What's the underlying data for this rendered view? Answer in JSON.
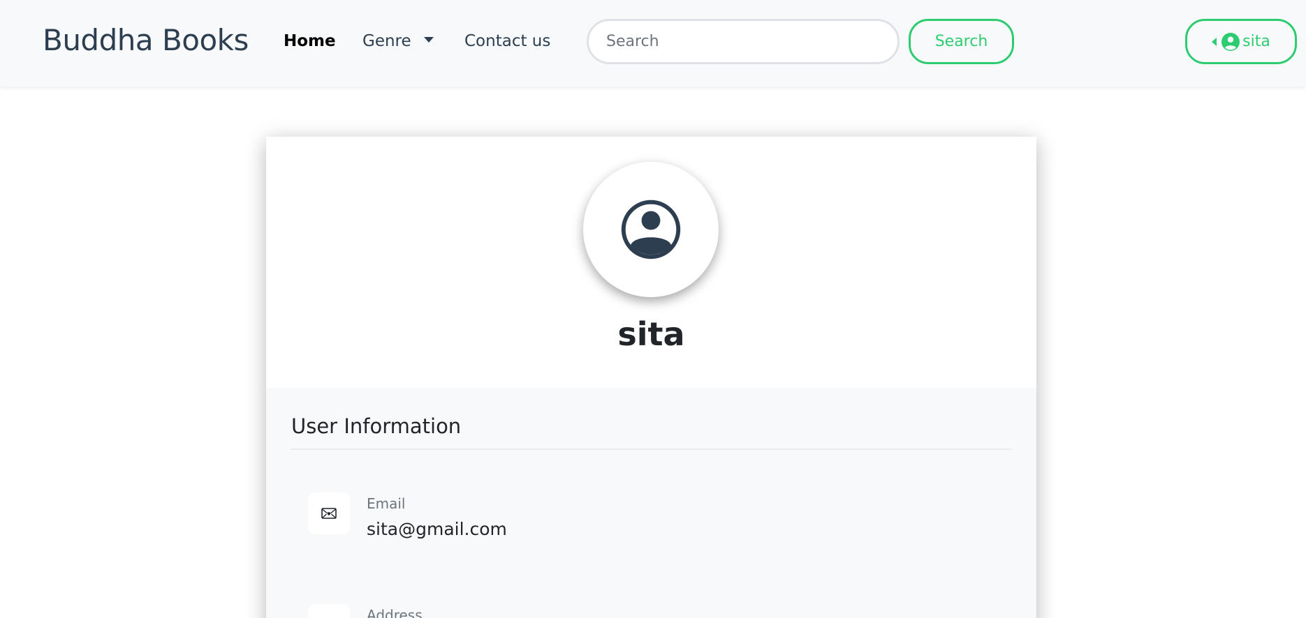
{
  "navbar": {
    "brand": "Buddha Books",
    "links": {
      "home": "Home",
      "genre": "Genre",
      "contact": "Contact us"
    },
    "search": {
      "placeholder": "Search",
      "button_label": "Search"
    },
    "user_button_label": "sita"
  },
  "profile": {
    "username": "sita",
    "section_title": "User Information",
    "email": {
      "label": "Email",
      "value": "sita@gmail.com"
    },
    "address": {
      "label": "Address"
    }
  },
  "colors": {
    "accent": "#2ecc71",
    "brand": "#2c3e50",
    "navbar_bg": "#f8f9fa"
  }
}
